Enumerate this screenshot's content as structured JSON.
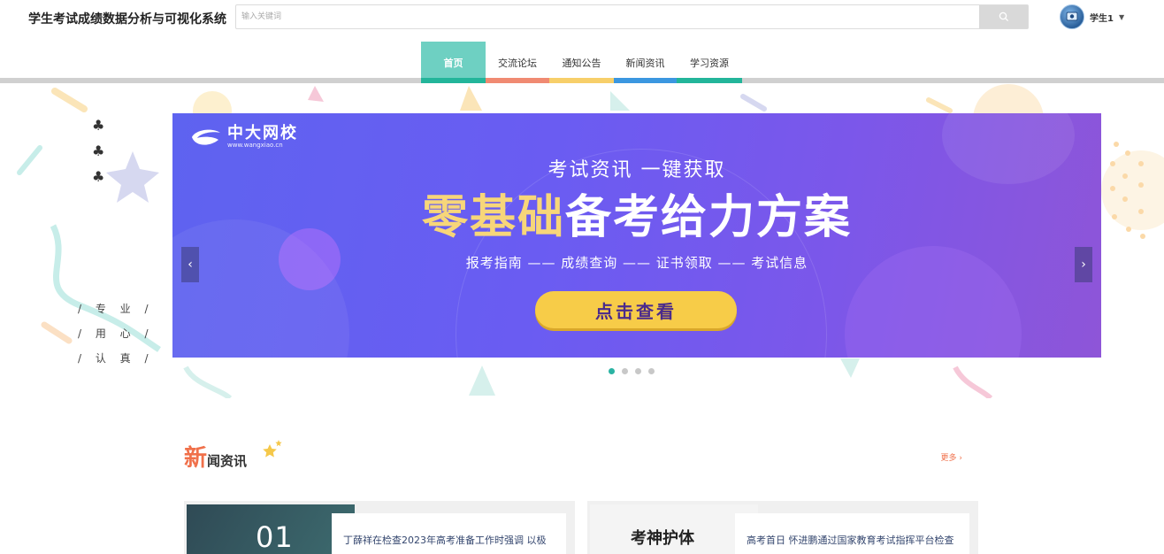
{
  "header": {
    "site_title": "学生考试成绩数据分析与可视化系统",
    "search_placeholder": "输入关键词",
    "user_name": "学生1",
    "search_icon": "search-icon",
    "caret_icon": "caret-down-icon"
  },
  "nav": {
    "items": [
      {
        "label": "首页",
        "color": "#6ed0c2",
        "active": true
      },
      {
        "label": "交流论坛",
        "color": "#f08a72"
      },
      {
        "label": "通知公告",
        "color": "#f7cf6a"
      },
      {
        "label": "新闻资讯",
        "color": "#3b97e0"
      },
      {
        "label": "学习资源",
        "color": "#23b59a"
      }
    ]
  },
  "side": {
    "suits": [
      "♣",
      "♣",
      "♣"
    ],
    "slogans": [
      "/ 专 业 /",
      "/ 用 心 /",
      "/ 认 真 /"
    ]
  },
  "banner": {
    "logo_text": "中大网校",
    "logo_url_text": "www.wangxiao.cn",
    "subtitle": "考试资讯 一键获取",
    "headline_highlight": "零基础",
    "headline_rest": "备考给力方案",
    "steps": "报考指南 —— 成绩查询 —— 证书领取 —— 考试信息",
    "button_label": "点击查看",
    "prev_arrow": "‹",
    "next_arrow": "›",
    "slide_count": 4,
    "active_slide": 1
  },
  "news": {
    "heading_first": "新",
    "heading_rest": "闻资讯",
    "more_label": "更多 ›",
    "items": [
      {
        "image_text": "01",
        "title": "丁薛祥在检查2023年高考准备工作时强调 以极"
      },
      {
        "image_text": "考神护体",
        "title": "高考首日 怀进鹏通过国家教育考试指挥平台检查"
      }
    ]
  },
  "colors": {
    "accent_teal": "#6ed0c2",
    "news_orange": "#f0704a",
    "banner_purple": "#6a5cf2",
    "button_yellow": "#f7cc48"
  }
}
